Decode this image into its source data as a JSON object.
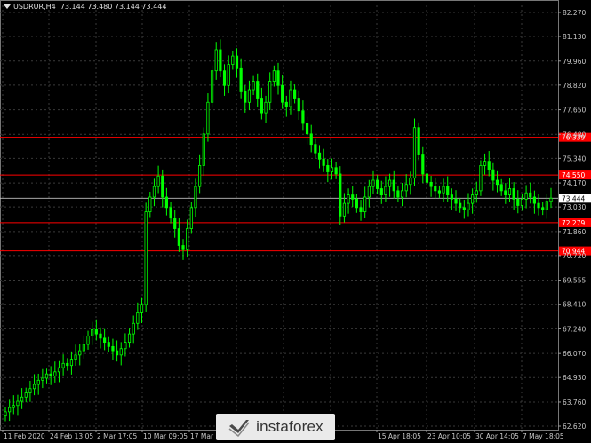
{
  "header": {
    "symbol": "USDRUR,H4",
    "ohlc": "73.144 73.480 73.144 73.444"
  },
  "watermark": {
    "brand": "instaforex",
    "icon": "instaforex-logo-icon"
  },
  "colors": {
    "background": "#000000",
    "candle": "#00ff00",
    "grid": "#3a3a3a",
    "level": "#ff0000",
    "current_price": "#c0c0c0"
  },
  "chart_data": {
    "type": "candlestick",
    "y_ticks": [
      "82.270",
      "81.130",
      "79.960",
      "78.820",
      "77.650",
      "76.480",
      "75.340",
      "74.170",
      "73.030",
      "71.860",
      "70.720",
      "69.555",
      "68.410",
      "67.240",
      "66.070",
      "64.930",
      "63.760",
      "62.620"
    ],
    "ylim": [
      62.62,
      82.27
    ],
    "x_ticks": [
      "11 Feb 2020",
      "24 Feb 13:05",
      "2 Mar 17:05",
      "10 Mar 09:05",
      "17 Mar",
      "15 Apr 18:05",
      "23 Apr 10:05",
      "30 Apr 14:05",
      "7 May 18:05"
    ],
    "levels": [
      {
        "label": "76.339",
        "value": 76.339
      },
      {
        "label": "74.550",
        "value": 74.55
      },
      {
        "label": "72.279",
        "value": 72.279
      },
      {
        "label": "70.944",
        "value": 70.944
      }
    ],
    "current_price": {
      "label": "73.444",
      "value": 73.444
    },
    "closes": [
      63.3,
      63.5,
      63.6,
      63.8,
      64.0,
      64.2,
      64.4,
      64.6,
      64.8,
      64.9,
      65.1,
      65.0,
      65.2,
      65.4,
      65.6,
      65.5,
      65.8,
      66.0,
      66.2,
      66.5,
      66.9,
      67.2,
      67.0,
      66.8,
      66.6,
      66.4,
      66.2,
      66.0,
      66.3,
      66.6,
      67.0,
      67.5,
      68.0,
      68.4,
      72.8,
      73.5,
      74.0,
      74.5,
      73.5,
      73.0,
      72.5,
      72.0,
      71.2,
      71.0,
      72.0,
      73.0,
      74.0,
      75.0,
      76.5,
      78.0,
      79.5,
      80.5,
      79.5,
      78.8,
      79.8,
      80.2,
      79.6,
      78.5,
      78.0,
      78.6,
      79.0,
      78.2,
      77.5,
      78.0,
      79.0,
      79.5,
      78.8,
      78.0,
      77.8,
      78.6,
      78.2,
      77.6,
      77.0,
      76.5,
      76.0,
      75.6,
      75.3,
      75.0,
      74.7,
      74.9,
      74.6,
      72.6,
      73.2,
      73.6,
      73.4,
      73.0,
      72.8,
      73.5,
      74.0,
      74.3,
      73.9,
      73.6,
      74.0,
      74.3,
      73.8,
      73.5,
      73.8,
      74.1,
      74.4,
      76.8,
      75.5,
      74.6,
      74.2,
      74.0,
      73.8,
      73.7,
      74.0,
      73.6,
      73.4,
      73.2,
      73.0,
      72.9,
      73.2,
      73.6,
      73.8,
      75.0,
      75.2,
      74.8,
      74.3,
      74.1,
      73.8,
      73.6,
      73.9,
      73.4,
      73.1,
      73.4,
      73.7,
      73.5,
      73.2,
      73.0,
      72.9,
      73.3,
      73.444
    ]
  }
}
